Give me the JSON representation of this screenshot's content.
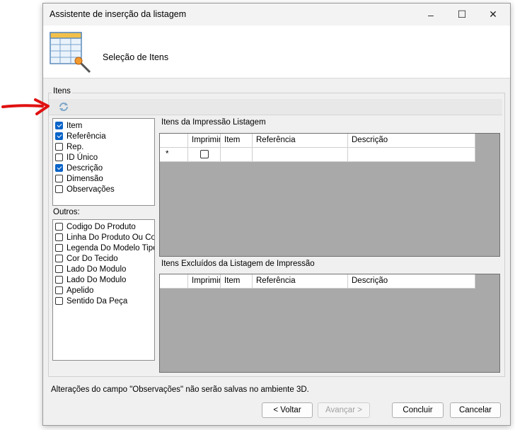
{
  "window": {
    "title": "Assistente de inserção da listagem",
    "header_title": "Seleção de Itens"
  },
  "controls": {
    "minimize": "–",
    "maximize": "☐",
    "close": "✕"
  },
  "group_label": "Itens",
  "fields": [
    {
      "label": "Item",
      "checked": true
    },
    {
      "label": "Referência",
      "checked": true
    },
    {
      "label": "Rep.",
      "checked": false
    },
    {
      "label": "ID Único",
      "checked": false
    },
    {
      "label": "Descrição",
      "checked": true
    },
    {
      "label": "Dimensão",
      "checked": false
    },
    {
      "label": "Observações",
      "checked": false
    }
  ],
  "outros_label": "Outros:",
  "outros": [
    {
      "label": "Codigo Do Produto",
      "checked": false
    },
    {
      "label": "Linha Do Produto Ou Coc",
      "checked": false
    },
    {
      "label": "Legenda Do Modelo Tipo",
      "checked": false
    },
    {
      "label": "Cor Do Tecido",
      "checked": false
    },
    {
      "label": "Lado Do Modulo",
      "checked": false
    },
    {
      "label": "Lado Do Modulo",
      "checked": false
    },
    {
      "label": "Apelido",
      "checked": false
    },
    {
      "label": "Sentido Da Peça",
      "checked": false
    }
  ],
  "grid_print": {
    "label": "Itens da Impressão Listagem",
    "columns": [
      "",
      "Imprimir",
      "Item",
      "Referência",
      "Descrição"
    ],
    "new_row_marker": "*"
  },
  "grid_excluded": {
    "label": "Itens Excluídos da Listagem de Impressão",
    "columns": [
      "",
      "Imprimir",
      "Item",
      "Referência",
      "Descrição"
    ]
  },
  "note": "Alterações do campo \"Observações\" não serão salvas no ambiente 3D.",
  "buttons": {
    "back": "< Voltar",
    "next": "Avançar >",
    "finish": "Concluir",
    "cancel": "Cancelar"
  },
  "colors": {
    "accent": "#0a64c8",
    "annotation_arrow": "#e01010",
    "grid_background": "#a9a9a9"
  }
}
